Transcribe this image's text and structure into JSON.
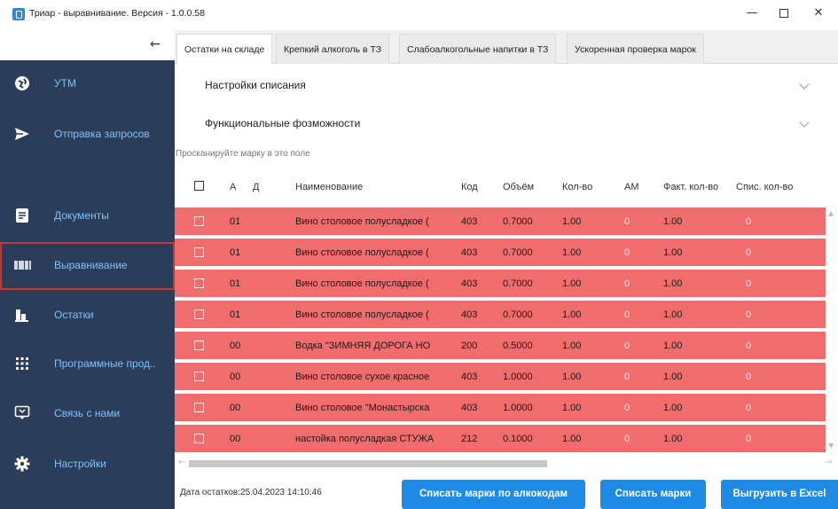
{
  "window": {
    "title": "Триар - выравнивание. Версия - 1.0.0.58",
    "min_glyph": "—",
    "close_glyph": "✕"
  },
  "sidebar": {
    "back_glyph": "←",
    "items": [
      {
        "label": "УТМ",
        "icon": "globe-icon"
      },
      {
        "label": "Отправка запросов",
        "icon": "send-icon"
      },
      {
        "label": "Документы",
        "icon": "document-icon"
      },
      {
        "label": "Выравнивание",
        "icon": "barcode-icon",
        "active": true
      },
      {
        "label": "Остатки",
        "icon": "bar-chart-icon"
      },
      {
        "label": "Программные прод..",
        "icon": "grid-icon"
      },
      {
        "label": "Связь с нами",
        "icon": "chat-icon"
      },
      {
        "label": "Настройки",
        "icon": "gear-icon"
      }
    ]
  },
  "tabs": [
    {
      "label": "Остатки на складе",
      "active": true
    },
    {
      "label": "Крепкий алкоголь в ТЗ"
    },
    {
      "label": "Слабоалкогольные напитки в ТЗ"
    },
    {
      "label": "Ускоренная проверка марок"
    }
  ],
  "accordions": {
    "write_off_settings": "Настройки списания",
    "features": "Функциональные фозможности"
  },
  "scan": {
    "placeholder": "Просканируйте марку в это поле"
  },
  "table": {
    "headers": {
      "a": "А",
      "d": "Д",
      "name": "Наименование",
      "code": "Код",
      "volume": "Объём",
      "qty": "Кол-во",
      "am": "АМ",
      "fact_qty": "Факт. кол-во",
      "spis_qty": "Спис. кол-во"
    },
    "rows": [
      {
        "a": "01",
        "name": "Вино столовое полусладкое (",
        "code": "403",
        "volume": "0.7000",
        "qty": "1.00",
        "am": "0",
        "fact": "1.00",
        "spis": "0"
      },
      {
        "a": "01",
        "name": "Вино столовое полусладкое (",
        "code": "403",
        "volume": "0.7000",
        "qty": "1.00",
        "am": "0",
        "fact": "1.00",
        "spis": "0"
      },
      {
        "a": "01",
        "name": "Вино столовое полусладкое (",
        "code": "403",
        "volume": "0.7000",
        "qty": "1.00",
        "am": "0",
        "fact": "1.00",
        "spis": "0"
      },
      {
        "a": "01",
        "name": "Вино столовое полусладкое (",
        "code": "403",
        "volume": "0.7000",
        "qty": "1.00",
        "am": "0",
        "fact": "1.00",
        "spis": "0"
      },
      {
        "a": "00",
        "name": "Водка \"ЗИМНЯЯ ДОРОГА НО",
        "code": "200",
        "volume": "0.5000",
        "qty": "1.00",
        "am": "0",
        "fact": "1.00",
        "spis": "0"
      },
      {
        "a": "00",
        "name": "Вино столовое сухое красное",
        "code": "403",
        "volume": "1.0000",
        "qty": "1.00",
        "am": "0",
        "fact": "1.00",
        "spis": "0"
      },
      {
        "a": "00",
        "name": "Вино столовое \"Монастырска",
        "code": "403",
        "volume": "1.0000",
        "qty": "1.00",
        "am": "0",
        "fact": "1.00",
        "spis": "0"
      },
      {
        "a": "00",
        "name": "настойка полусладкая СТУЖА",
        "code": "212",
        "volume": "0.1000",
        "qty": "1.00",
        "am": "0",
        "fact": "1.00",
        "spis": "0"
      }
    ]
  },
  "footer": {
    "stock_date": "Дата остатков:25.04.2023 14:10:46",
    "btn_write_off_by_alcocodes": "Списать марки по алкокодам",
    "btn_write_off": "Списать марки",
    "btn_export_excel": "Выгрузить в Excel"
  },
  "colors": {
    "sidebar_bg": "#2b3d59",
    "nav_label": "#7ec2ff",
    "active_border": "#d0342c",
    "row_highlight": "#f16c6c",
    "primary_button": "#1e8ae6"
  }
}
